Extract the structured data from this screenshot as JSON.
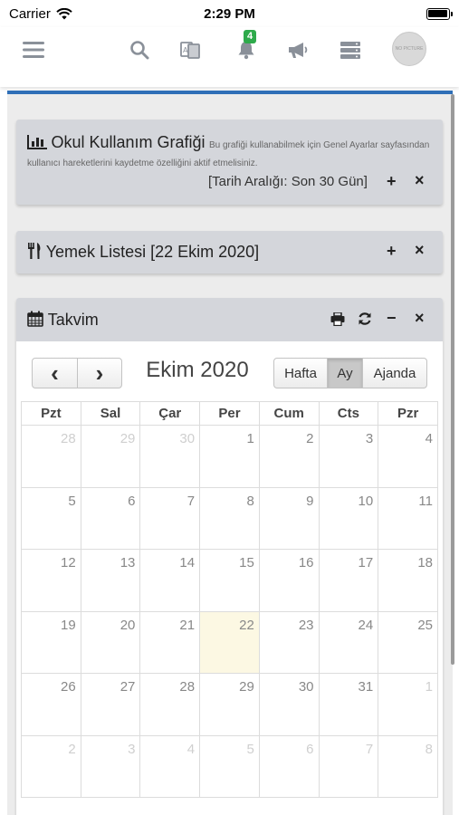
{
  "status_bar": {
    "carrier": "Carrier",
    "time": "2:29 PM"
  },
  "navbar": {
    "icons": [
      "menu-icon",
      "search-icon",
      "language-icon",
      "bell-icon",
      "megaphone-icon",
      "server-icon"
    ],
    "notification_count": "4",
    "avatar_text": "NO PICTURE"
  },
  "colors": {
    "accent_bar": "#2f6fb7",
    "badge": "#2eaa4b",
    "today_highlight": "#fcf8e3",
    "panel_header": "#d4d6db"
  },
  "usage_panel": {
    "title": "Okul Kullanım Grafiği",
    "note": "Bu grafiği kullanabilmek için Genel Ayarlar sayfasından kullanıcı hareketlerini kaydetme özelliğini aktif etmelisiniz.",
    "date_range": "[Tarih Aralığı: Son 30 Gün]",
    "add": "+",
    "close": "×"
  },
  "menu_panel": {
    "title": "Yemek Listesi [22 Ekim 2020]",
    "add": "+",
    "close": "×"
  },
  "calendar_panel": {
    "title": "Takvim",
    "print": "print-icon",
    "refresh": "refresh-icon",
    "minimize": "−",
    "close": "×",
    "prev": "‹",
    "next": "›",
    "month_title": "Ekim 2020",
    "views": [
      "Hafta",
      "Ay",
      "Ajanda"
    ],
    "active_view": "Ay",
    "weekdays": [
      "Pzt",
      "Sal",
      "Çar",
      "Per",
      "Cum",
      "Cts",
      "Pzr"
    ],
    "weeks": [
      [
        "28",
        "29",
        "30",
        "1",
        "2",
        "3",
        "4"
      ],
      [
        "5",
        "6",
        "7",
        "8",
        "9",
        "10",
        "11"
      ],
      [
        "12",
        "13",
        "14",
        "15",
        "16",
        "17",
        "18"
      ],
      [
        "19",
        "20",
        "21",
        "22",
        "23",
        "24",
        "25"
      ],
      [
        "26",
        "27",
        "28",
        "29",
        "30",
        "31",
        "1"
      ],
      [
        "2",
        "3",
        "4",
        "5",
        "6",
        "7",
        "8"
      ]
    ],
    "today": "22"
  }
}
